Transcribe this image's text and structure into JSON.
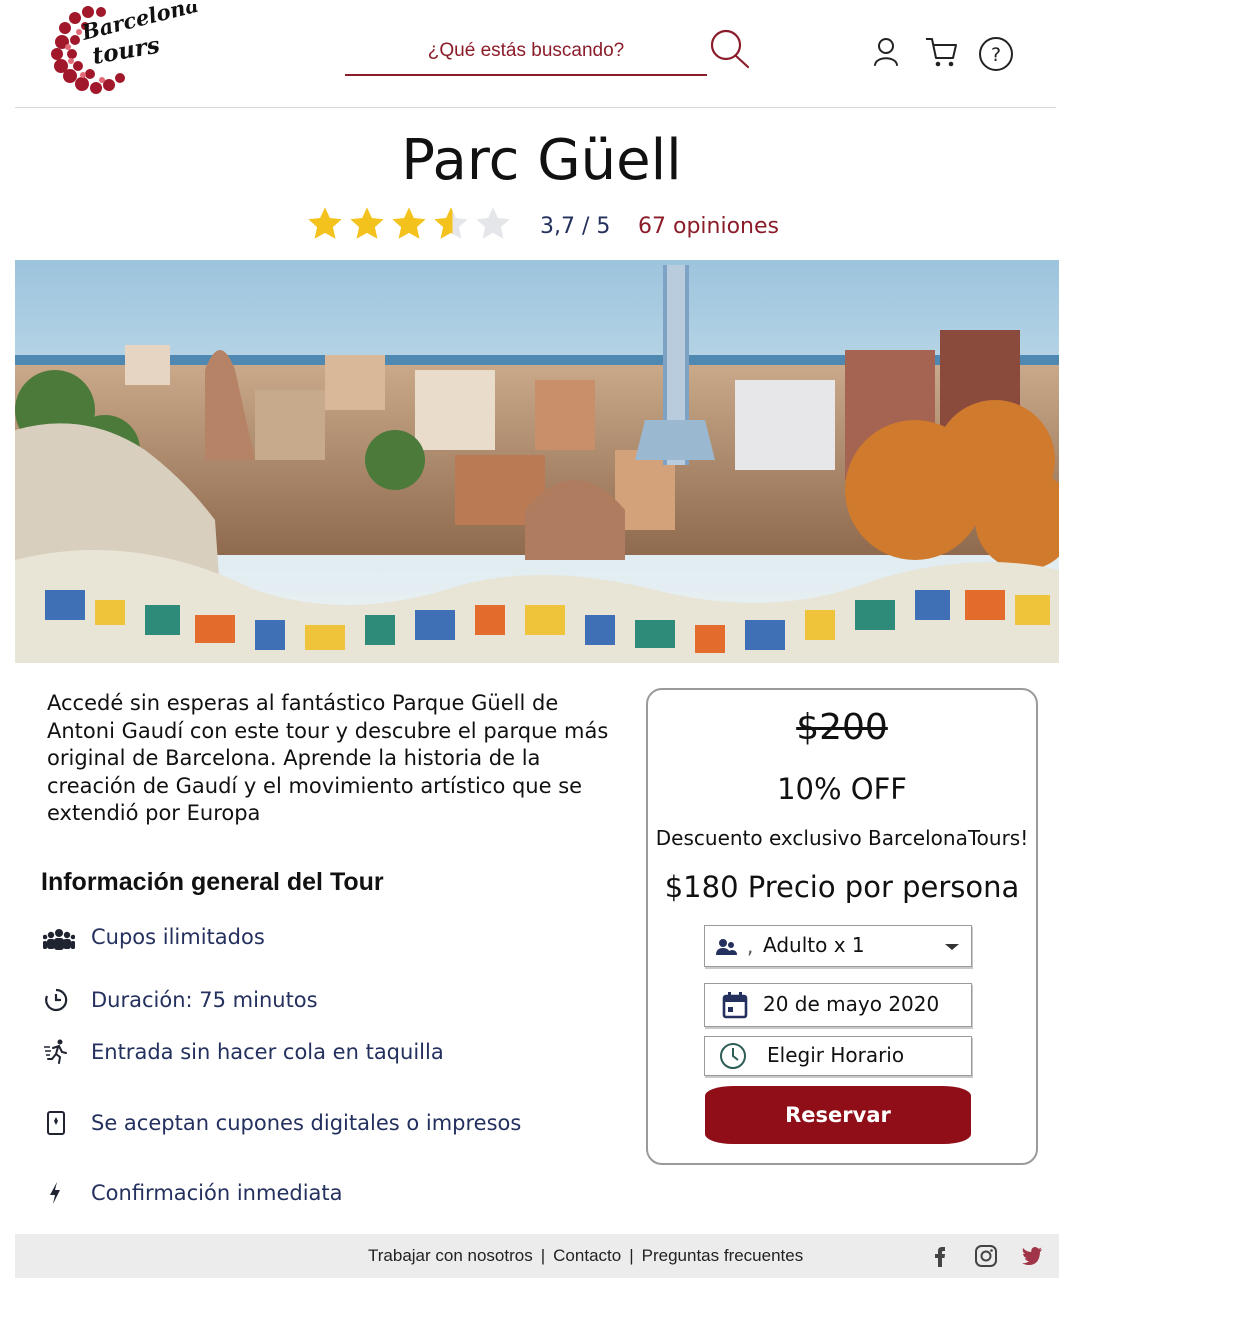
{
  "brand": {
    "logo_line1": "Barcelona",
    "logo_line2": "tours",
    "accent_color": "#8b1d2b"
  },
  "header": {
    "search_placeholder": "¿Qué estás buscando?",
    "icons": [
      "search-icon",
      "user-icon",
      "cart-icon",
      "help-icon"
    ]
  },
  "tour": {
    "title": "Parc Güell",
    "rating": {
      "stars_value": 3.7,
      "max_stars": 5,
      "score_text": "3,7 / 5",
      "reviews_text": "67 opiniones"
    },
    "description": "Accedé sin esperas al fantástico Parque Güell de Antoni Gaudí con este tour y descubre el parque más original de Barcelona. Aprende la historia de la creación de Gaudí y el movimiento artístico que se extendió por Europa"
  },
  "info": {
    "title": "Información general del Tour",
    "features": [
      {
        "icon": "group-icon",
        "text": "Cupos ilimitados"
      },
      {
        "icon": "clock-icon",
        "text": "Duración: 75 minutos"
      },
      {
        "icon": "runner-icon",
        "text": "Entrada sin hacer cola en taquilla"
      },
      {
        "icon": "ticket-icon",
        "text": "Se aceptan cupones digitales o impresos"
      },
      {
        "icon": "lightning-icon",
        "text": "Confirmación inmediata"
      }
    ]
  },
  "booking": {
    "old_price": "$200",
    "discount": "10% OFF",
    "exclusive": "Descuento exclusivo BarcelonaTours!",
    "price": "$180 Precio por persona",
    "travelers_value": "Adulto x 1",
    "travelers_prefix": ",",
    "date_value": "20 de mayo 2020",
    "time_value": "Elegir Horario",
    "reserve_label": "Reservar",
    "button_color": "#8f0e18"
  },
  "footer": {
    "links": [
      "Trabajar con nosotros",
      "Contacto",
      "Preguntas frecuentes"
    ],
    "separator": "|",
    "social": [
      "facebook-icon",
      "instagram-icon",
      "twitter-icon"
    ]
  }
}
